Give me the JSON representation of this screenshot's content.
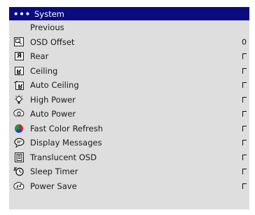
{
  "menu": {
    "title_dots": "•••",
    "title": "System",
    "previous_label": "Previous",
    "items": [
      {
        "label": "OSD Offset",
        "icon": "osd-offset-icon",
        "value": "0"
      },
      {
        "label": "Rear",
        "icon": "rear-icon",
        "glyph": "R",
        "checked": false
      },
      {
        "label": "Ceiling",
        "icon": "ceiling-icon",
        "glyph": "R",
        "checked": false
      },
      {
        "label": "Auto Ceiling",
        "icon": "auto-ceiling-icon",
        "glyph": "R",
        "checked": false
      },
      {
        "label": "High Power",
        "icon": "high-power-icon",
        "checked": false
      },
      {
        "label": "Auto Power",
        "icon": "auto-power-icon",
        "checked": false
      },
      {
        "label": "Fast Color Refresh",
        "icon": "fast-color-refresh-icon",
        "checked": false
      },
      {
        "label": "Display Messages",
        "icon": "display-messages-icon",
        "checked": false
      },
      {
        "label": "Translucent OSD",
        "icon": "translucent-osd-icon",
        "checked": false
      },
      {
        "label": "Sleep Timer",
        "icon": "sleep-timer-icon",
        "checked": false
      },
      {
        "label": "Power Save",
        "icon": "power-save-icon",
        "checked": false
      }
    ]
  },
  "colors": {
    "title_bar": "#0b0b80",
    "menu_background": "#dedede",
    "fast_color_icon": [
      "#d42020",
      "#1e3fd4",
      "#1f9a2a"
    ]
  }
}
